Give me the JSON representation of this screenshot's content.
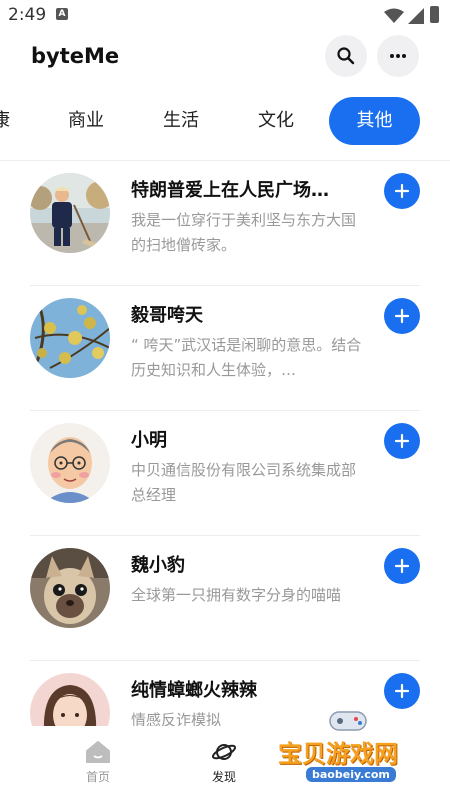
{
  "status_bar": {
    "time": "2:49"
  },
  "app": {
    "title": "byteMe"
  },
  "tabs": [
    {
      "label": "康"
    },
    {
      "label": "商业"
    },
    {
      "label": "生活"
    },
    {
      "label": "文化"
    },
    {
      "label": "其他",
      "active": true
    }
  ],
  "items": [
    {
      "name": "特朗普爱上在人民广场…",
      "desc": "我是一位穿行于美利坚与东方大国的扫地僧砖家。",
      "avatar_icon": "man-sweeping-photo"
    },
    {
      "name": "毅哥咵天",
      "desc": "“ 咵天”武汉话是闲聊的意思。结合历史知识和人生体验，…",
      "avatar_icon": "tree-sky-photo"
    },
    {
      "name": "小明",
      "desc": "中贝通信股份有限公司系统集成部总经理",
      "avatar_icon": "cartoon-man-glasses"
    },
    {
      "name": "魏小豹",
      "desc": "全球第一只拥有数字分身的喵喵",
      "avatar_icon": "cat-photo"
    },
    {
      "name": "纯情蟑螂火辣辣",
      "desc": "情感反诈模拟",
      "avatar_icon": "woman-photo"
    }
  ],
  "bottom_nav": [
    {
      "label": "首页",
      "icon": "home-icon"
    },
    {
      "label": "发现",
      "icon": "planet-icon",
      "active": true
    }
  ],
  "watermark": {
    "text": "宝贝游戏网",
    "url": "baobeiy.com"
  },
  "colors": {
    "accent": "#1a6ff0",
    "muted_text": "#999999"
  }
}
